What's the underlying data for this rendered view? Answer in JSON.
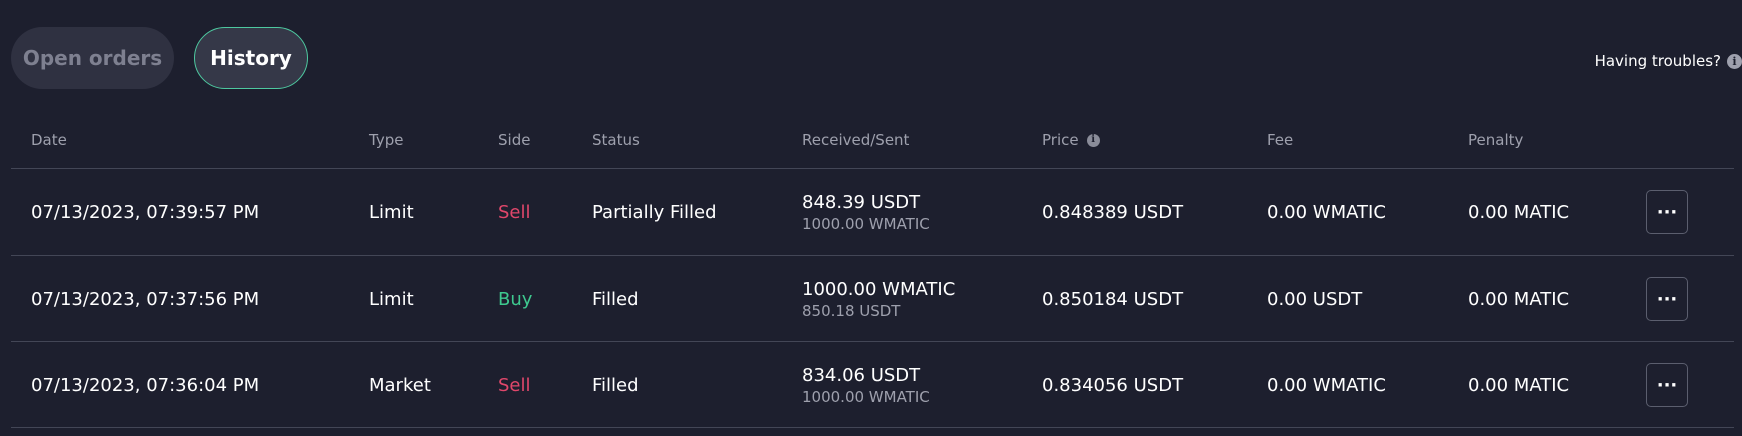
{
  "tabs": [
    {
      "label": "Open orders",
      "active": false
    },
    {
      "label": "History",
      "active": true
    }
  ],
  "help": {
    "label": "Having troubles?",
    "icon": "info-icon"
  },
  "table": {
    "headers": [
      "Date",
      "Type",
      "Side",
      "Status",
      "Received/Sent",
      "Price",
      "Fee",
      "Penalty"
    ],
    "rows": [
      {
        "date": "07/13/2023, 07:39:57 PM",
        "type": "Limit",
        "side": "Sell",
        "status": "Partially Filled",
        "received": "848.39 USDT",
        "sent": "1000.00 WMATIC",
        "price": "0.848389 USDT",
        "fee": "0.00 WMATIC",
        "penalty": "0.00 MATIC",
        "more": "···"
      },
      {
        "date": "07/13/2023, 07:37:56 PM",
        "type": "Limit",
        "side": "Buy",
        "status": "Filled",
        "received": "1000.00 WMATIC",
        "sent": "850.18 USDT",
        "price": "0.850184 USDT",
        "fee": "0.00 USDT",
        "penalty": "0.00 MATIC",
        "more": "···"
      },
      {
        "date": "07/13/2023, 07:36:04 PM",
        "type": "Market",
        "side": "Sell",
        "status": "Filled",
        "received": "834.06 USDT",
        "sent": "1000.00 WMATIC",
        "price": "0.834056 USDT",
        "fee": "0.00 WMATIC",
        "penalty": "0.00 MATIC",
        "more": "···"
      }
    ]
  },
  "colors": {
    "background": "#1d1f2e",
    "sell": "#e0476b",
    "buy": "#3ec98f",
    "active_tab_border": "#4ec9a0",
    "muted_text": "#9ea0ad"
  }
}
